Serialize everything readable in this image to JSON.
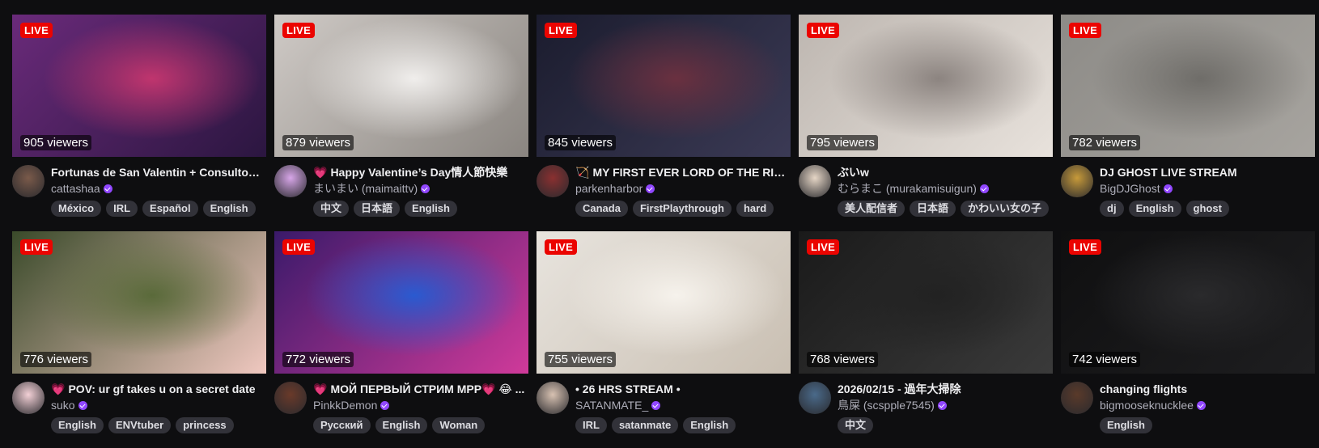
{
  "live_label": "LIVE",
  "streams": [
    {
      "viewers": "905 viewers",
      "title_emoji": "",
      "title": "Fortunas de San Valentin + Consultorio amoroso",
      "channel": "cattashaa",
      "tags": [
        "México",
        "IRL",
        "Español",
        "English"
      ],
      "thumb_colors": [
        "#6a2a7a",
        "#2b1640",
        "#c0356e"
      ],
      "avatar_color": "#7a5a4a"
    },
    {
      "viewers": "879 viewers",
      "title_emoji": "💗",
      "title": "Happy Valentine’s Day情人節快樂",
      "channel": "まいまい (maimaittv)",
      "tags": [
        "中文",
        "日本語",
        "English"
      ],
      "thumb_colors": [
        "#cfcac6",
        "#8a8580",
        "#f0eeec"
      ],
      "avatar_color": "#d7a6e8"
    },
    {
      "viewers": "845 viewers",
      "title_emoji": "🏹",
      "title": "MY FIRST EVER LORD OF THE RINGS",
      "channel": "parkenharbor",
      "tags": [
        "Canada",
        "FirstPlaythrough",
        "hard"
      ],
      "thumb_colors": [
        "#1b1c2e",
        "#3b3a55",
        "#6a3040"
      ],
      "avatar_color": "#8a3030"
    },
    {
      "viewers": "795 viewers",
      "title_emoji": "",
      "title": "ぶいw",
      "channel": "むらまこ (murakamisuigun)",
      "tags": [
        "美人配信者",
        "日本語",
        "かわいい女の子"
      ],
      "thumb_colors": [
        "#bdb6b0",
        "#e8e2dc",
        "#8c8480"
      ],
      "avatar_color": "#e6d6c6"
    },
    {
      "viewers": "782 viewers",
      "title_emoji": "",
      "title": "DJ GHOST LIVE STREAM",
      "channel": "BigDJGhost",
      "tags": [
        "dj",
        "English",
        "ghost"
      ],
      "thumb_colors": [
        "#8d8b87",
        "#a7a49f",
        "#6f6d69"
      ],
      "avatar_color": "#c79a3a"
    },
    {
      "viewers": "776 viewers",
      "title_emoji": "💗",
      "title": "POV: ur gf takes u on a secret date",
      "channel": "suko",
      "tags": [
        "English",
        "ENVtuber",
        "princess"
      ],
      "thumb_colors": [
        "#3a4a2a",
        "#f0c8c0",
        "#5a6a3a"
      ],
      "avatar_color": "#f3d0d6"
    },
    {
      "viewers": "772 viewers",
      "title_emoji": "💗",
      "title": "МОЙ ПЕРВЫЙ СТРИМ МРР💗 😂 ...",
      "channel": "PinkkDemon",
      "tags": [
        "Русский",
        "English",
        "Woman"
      ],
      "thumb_colors": [
        "#3a1a6a",
        "#d03a9a",
        "#2a5ad0"
      ],
      "avatar_color": "#6a3a2a"
    },
    {
      "viewers": "755 viewers",
      "title_emoji": "",
      "title": "• 26 HRS STREAM •",
      "channel": "SATANMATE_",
      "tags": [
        "IRL",
        "satanmate",
        "English"
      ],
      "thumb_colors": [
        "#e8e4de",
        "#c9bfb2",
        "#f6f2ec"
      ],
      "avatar_color": "#d8c2b2"
    },
    {
      "viewers": "768 viewers",
      "title_emoji": "",
      "title": "2026/02/15 - 過年大掃除",
      "channel": "鳥屎 (scspple7545)",
      "tags": [
        "中文"
      ],
      "thumb_colors": [
        "#1a1a1a",
        "#3a3a3a",
        "#222222"
      ],
      "avatar_color": "#4a6a8a"
    },
    {
      "viewers": "742 viewers",
      "title_emoji": "",
      "title": "changing flights",
      "channel": "bigmooseknucklee",
      "tags": [
        "English"
      ],
      "thumb_colors": [
        "#0f0f10",
        "#1e1e20",
        "#2a2a2c"
      ],
      "avatar_color": "#5a3a2a"
    }
  ]
}
